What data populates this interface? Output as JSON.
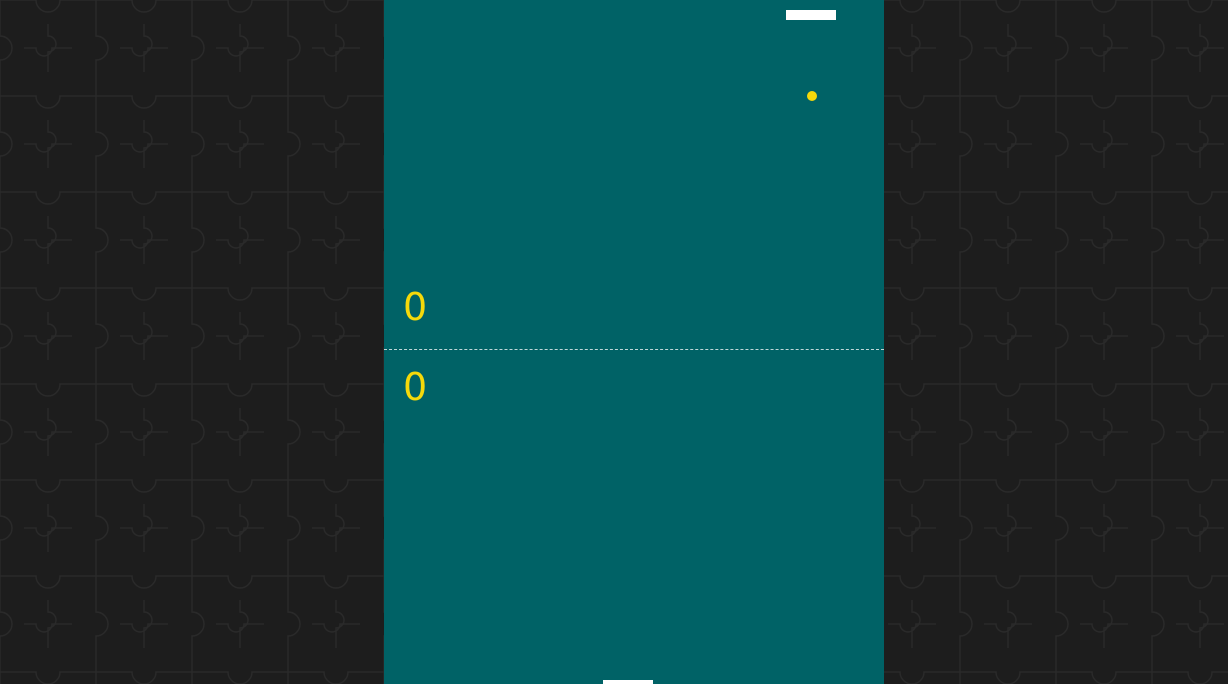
{
  "theme": {
    "background": "#1d1d1d",
    "pattern_stroke": "#2a2a2a",
    "court": "#006266",
    "score_color": "#f5d90a",
    "paddle_color": "#ffffff",
    "ball_color": "#f5d90a"
  },
  "background_pattern": "jigsaw-puzzle-piece",
  "scores": {
    "top": "0",
    "bottom": "0"
  }
}
